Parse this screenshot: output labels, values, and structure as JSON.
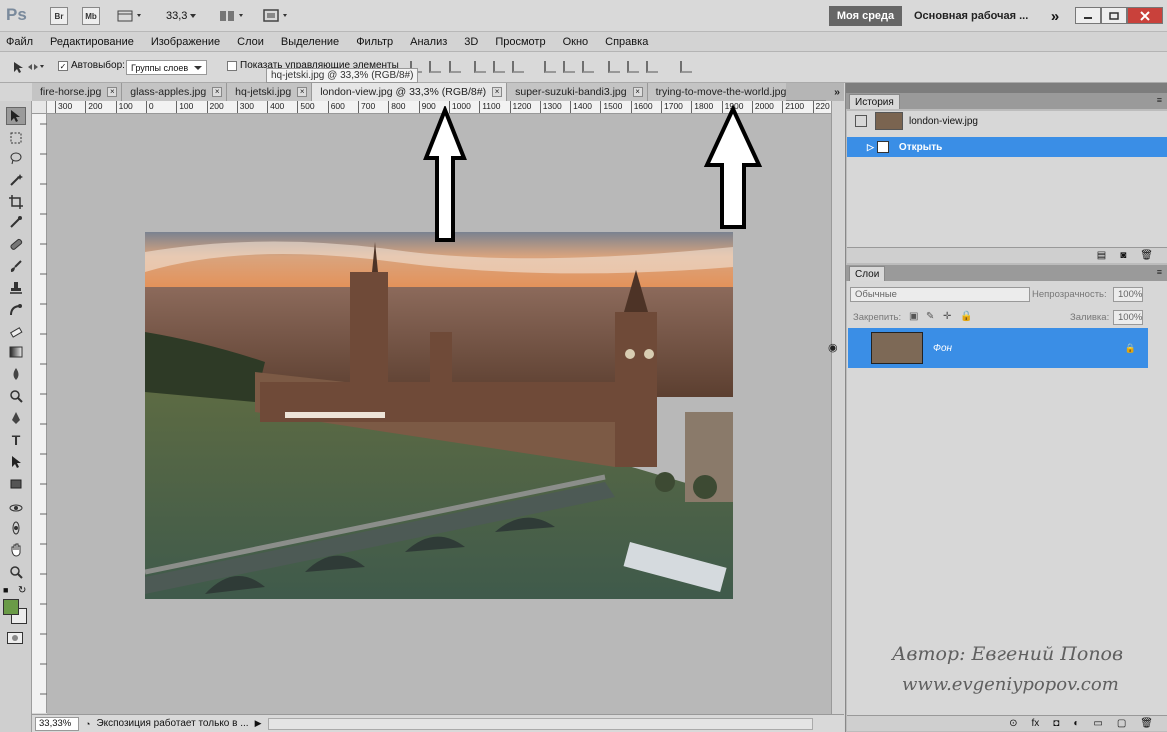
{
  "app": {
    "logo": "Ps",
    "buttons": [
      "Br",
      "Mb"
    ],
    "zoom_select": "33,3",
    "workspace_active": "Моя среда",
    "workspace_other": "Основная рабочая ...",
    "more": "»"
  },
  "menu": [
    "Файл",
    "Редактирование",
    "Изображение",
    "Слои",
    "Выделение",
    "Фильтр",
    "Анализ",
    "3D",
    "Просмотр",
    "Окно",
    "Справка"
  ],
  "options": {
    "autoselect_label": "Автовыбор:",
    "autoselect_value": "Группы слоев",
    "show_controls_label": "Показать управляющие элементы"
  },
  "tooltip": "hq-jetski.jpg @ 33,3% (RGB/8#)",
  "tabs": [
    {
      "label": "fire-horse.jpg"
    },
    {
      "label": "glass-apples.jpg"
    },
    {
      "label": "hq-jetski.jpg"
    },
    {
      "label": "london-view.jpg @ 33,3% (RGB/8#)"
    },
    {
      "label": "super-suzuki-bandi3.jpg"
    },
    {
      "label": "trying-to-move-the-world.jpg"
    }
  ],
  "ruler_h": [
    "300",
    "200",
    "100",
    "0",
    "100",
    "200",
    "300",
    "400",
    "500",
    "600",
    "700",
    "800",
    "900",
    "1000",
    "1100",
    "1200",
    "1300",
    "1400",
    "1500",
    "1600",
    "1700",
    "1800",
    "1900",
    "2000",
    "2100",
    "220"
  ],
  "status": {
    "zoom": "33,33%",
    "text": "Экспозиция работает только в ..."
  },
  "history": {
    "tab": "История",
    "snapshot": "london-view.jpg",
    "step": "Открыть"
  },
  "layers": {
    "tab": "Слои",
    "blend_mode": "Обычные",
    "opacity_label": "Непрозрачность:",
    "opacity_value": "100%",
    "lock_label": "Закрепить:",
    "fill_label": "Заливка:",
    "fill_value": "100%",
    "layer_name": "Фон"
  },
  "watermark": {
    "author": "Автор: Евгений Попов",
    "site": "www.evgeniypopov.com"
  },
  "colors": {
    "selection": "#3a8ee6",
    "foreground": "#6a9b47",
    "background": "#ececec"
  }
}
